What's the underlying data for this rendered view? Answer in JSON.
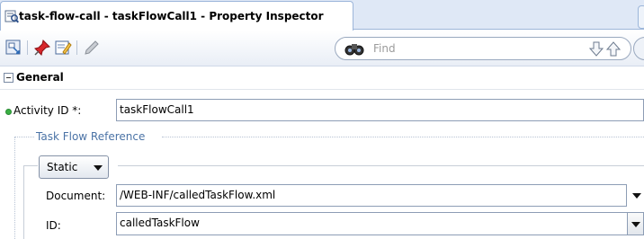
{
  "tab": {
    "title": "task-flow-call - taskFlowCall1 - Property Inspector",
    "icon": "property-inspector-icon"
  },
  "toolbar": {
    "icons": [
      "view-mode-icon",
      "pin-icon",
      "edit-properties-icon",
      "pencil-icon"
    ],
    "find_placeholder": "Find",
    "find_icon": "binoculars-icon"
  },
  "general": {
    "header": "General"
  },
  "activity": {
    "label": "Activity ID *:",
    "value": "taskFlowCall1",
    "required_color": "#3ab044"
  },
  "task_flow_reference": {
    "label": "Task Flow Reference",
    "mode": {
      "selected": "Static"
    },
    "document": {
      "label": "Document:",
      "value": "/WEB-INF/calledTaskFlow.xml"
    },
    "id": {
      "label": "ID:",
      "value": "calledTaskFlow"
    }
  },
  "colors": {
    "tab_border": "#9db6da",
    "section_label": "#4b73a6"
  }
}
